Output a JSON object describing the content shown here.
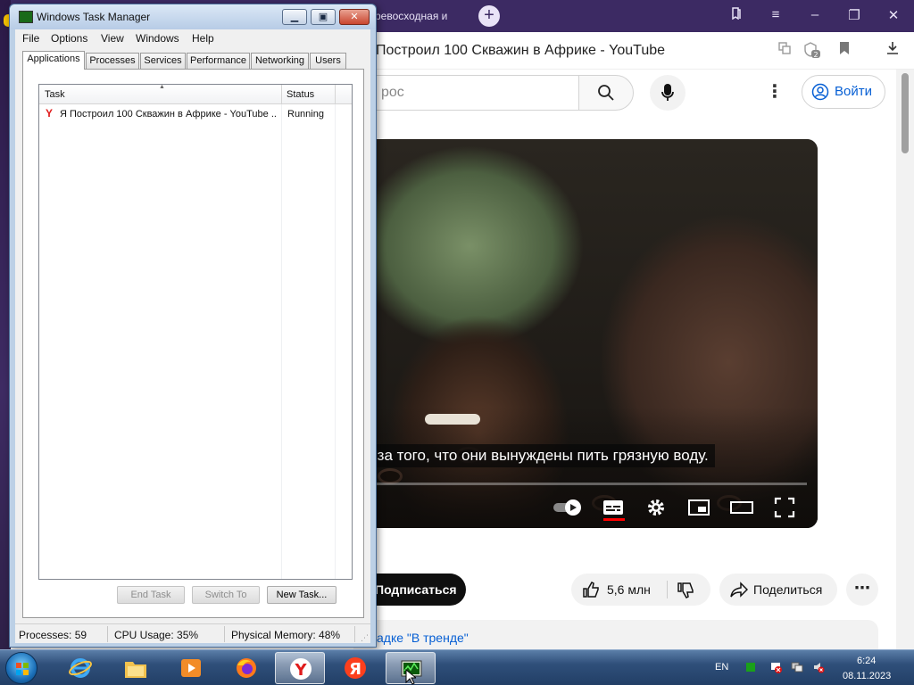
{
  "browser": {
    "tab_title": "ревосходная и",
    "new_tab_label": "+",
    "page_title": "Построил 100 Скважин в Африке - YouTube",
    "search_placeholder": "рос",
    "signin_label": "Войти",
    "subtitle_text": "-за того, что они вынуждены пить грязную воду.",
    "subscribe_label": "Подписаться",
    "like_count": "5,6 млн",
    "share_label": "Поделиться",
    "trending_text": "адке \"В тренде\"",
    "colors": {
      "tabbar": "#3c2a63",
      "link_blue": "#065fd4",
      "cc_red": "#ff0000"
    }
  },
  "task_manager": {
    "title": "Windows Task Manager",
    "menu": [
      "File",
      "Options",
      "View",
      "Windows",
      "Help"
    ],
    "tabs": [
      "Applications",
      "Processes",
      "Services",
      "Performance",
      "Networking",
      "Users"
    ],
    "active_tab": "Applications",
    "columns": [
      "Task",
      "Status"
    ],
    "rows": [
      {
        "task": "Я Построил 100 Скважин в Африке - YouTube ...",
        "status": "Running",
        "icon": "yandex-browser-icon"
      }
    ],
    "buttons": {
      "end_task": "End Task",
      "switch_to": "Switch To",
      "new_task": "New Task..."
    },
    "status": {
      "processes": "Processes: 59",
      "cpu": "CPU Usage: 35%",
      "memory": "Physical Memory: 48%"
    }
  },
  "taskbar": {
    "items": [
      "start-orb",
      "internet-explorer-icon",
      "file-explorer-icon",
      "media-player-icon",
      "firefox-icon",
      "yandex-browser-icon",
      "yandex-icon",
      "task-manager-icon"
    ],
    "lang": "EN",
    "time": "6:24",
    "date": "08.11.2023"
  }
}
